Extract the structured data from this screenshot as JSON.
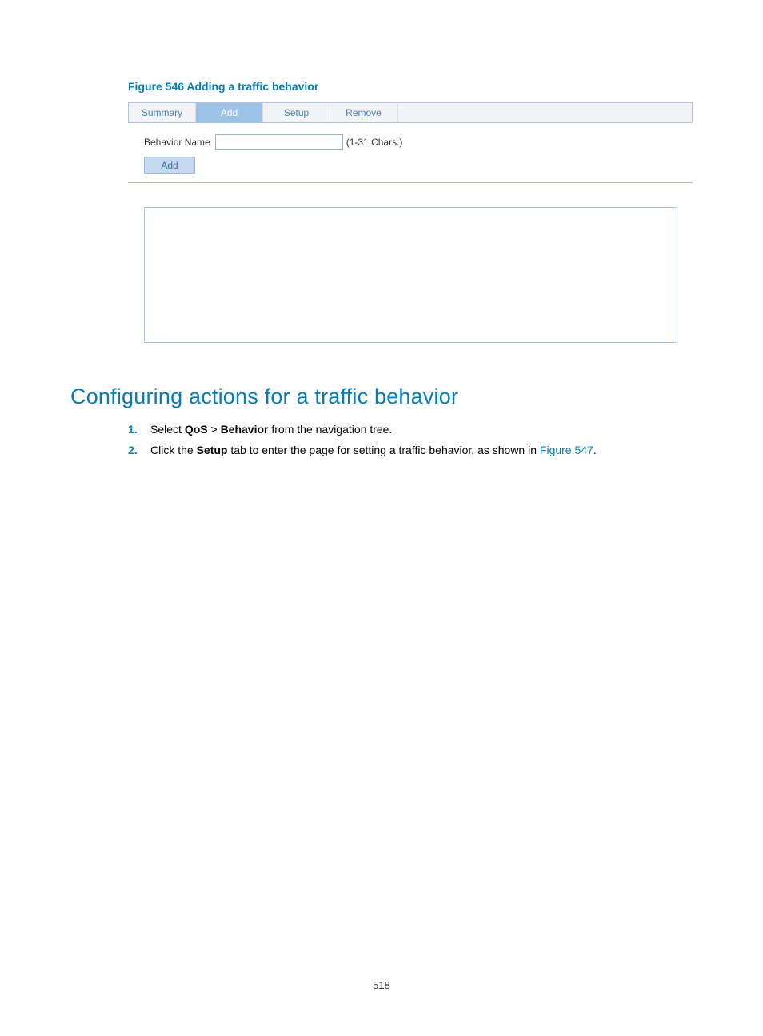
{
  "figure_caption": "Figure 546 Adding a traffic behavior",
  "tabs": {
    "summary": "Summary",
    "add": "Add",
    "setup": "Setup",
    "remove": "Remove"
  },
  "form": {
    "behavior_label": "Behavior Name",
    "behavior_value": "",
    "hint": "(1-31 Chars.)",
    "add_button": "Add"
  },
  "section_heading": "Configuring actions for a traffic behavior",
  "steps": {
    "n1": "1.",
    "n2": "2.",
    "s1_pre": "Select ",
    "s1_b1": "QoS",
    "s1_mid": " > ",
    "s1_b2": "Behavior",
    "s1_post": " from the navigation tree.",
    "s2_pre": "Click the ",
    "s2_b1": "Setup",
    "s2_mid": " tab to enter the page for setting a traffic behavior, as shown in ",
    "s2_link": "Figure 547",
    "s2_post": "."
  },
  "page_number": "518"
}
